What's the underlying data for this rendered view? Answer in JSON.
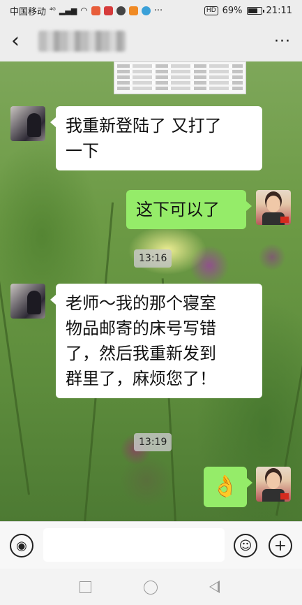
{
  "status_bar": {
    "carrier": "中国移动",
    "signal_label": "⁴ᴳ",
    "hd_label": "HD",
    "battery_percent": "69%",
    "time": "21:11"
  },
  "title_bar": {
    "back_icon": "chevron-left",
    "more_label": "···"
  },
  "messages": [
    {
      "side": "left",
      "text_lines": [
        "我重新登陆了 又打了",
        "一下"
      ]
    },
    {
      "side": "right",
      "text": "这下可以了"
    },
    {
      "time": "13:16"
    },
    {
      "side": "left",
      "text_lines": [
        "老师～我的那个寝室",
        "物品邮寄的床号写错",
        "了，然后我重新发到",
        "群里了，麻烦您了！"
      ]
    },
    {
      "time": "13:19"
    },
    {
      "side": "right",
      "emoji": "👌"
    }
  ],
  "input_bar": {
    "voice_icon": "voice-icon",
    "emoji_icon": "emoji-icon",
    "plus_icon": "plus-icon"
  },
  "colors": {
    "sent_bubble": "#95ec69",
    "received_bubble": "#ffffff",
    "bar_background": "#ededed"
  }
}
